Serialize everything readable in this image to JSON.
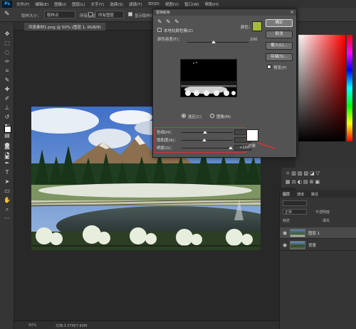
{
  "menu": {
    "logo": "Ps",
    "items": [
      "文件(F)",
      "编辑(E)",
      "图像(I)",
      "图层(L)",
      "文字(Y)",
      "选择(S)",
      "滤镜(T)",
      "3D(D)",
      "视图(V)",
      "窗口(W)",
      "帮助(H)"
    ]
  },
  "options": {
    "sample_label": "取样大小：",
    "sample_value": "取样点",
    "sample_all_label": "所有图层",
    "show_ring_label": "显示取样环"
  },
  "document": {
    "tab_title": "风景素材1.png @ 50% (图层 1, RGB/8)",
    "zoom": "50%",
    "doc_info": "文档:3.57M/7.60M"
  },
  "dialog": {
    "title": "替换颜色",
    "localized_label": "本地化颜色簇(Z)",
    "color_label": "颜色：",
    "fuzziness_label": "颜色容差(F)：",
    "fuzziness_value": "200",
    "selection_label": "选区(C)",
    "image_label": "图像(M)",
    "ok": "确定",
    "cancel": "取消",
    "load": "载入(L)...",
    "save": "存储(S)...",
    "preview_label": "预览(P)",
    "hue_label": "色相(H)：",
    "hue_value": "0",
    "saturation_label": "饱和度(A)：",
    "saturation_value": "-2",
    "lightness_label": "明度(G)：",
    "lightness_value": "+100",
    "result_label": "结果",
    "sample_color": "#a7ba38",
    "result_color": "#ffffff"
  },
  "panels": {
    "layers_tab": "图层",
    "channels_tab": "通道",
    "paths_tab": "路径",
    "blend_mode": "正常",
    "opacity_label": "不透明度",
    "lock_label": "锁定",
    "fill_label": "填充"
  },
  "layers": [
    {
      "name": "图层 1"
    },
    {
      "name": "背景"
    }
  ]
}
